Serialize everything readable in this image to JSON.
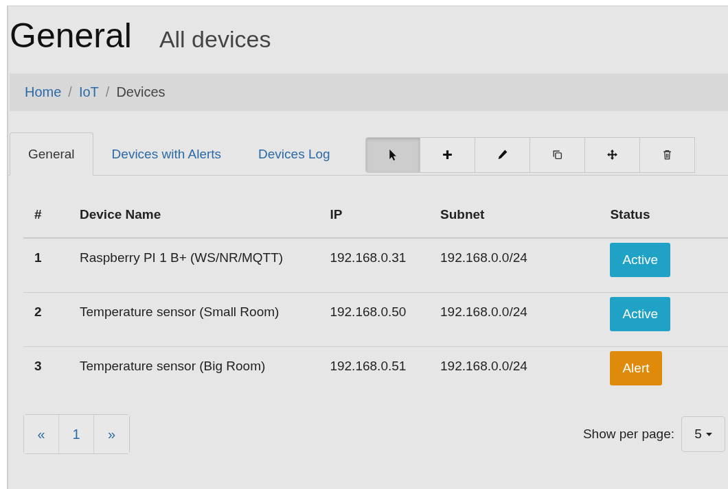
{
  "header": {
    "title": "General",
    "subtitle": "All devices"
  },
  "breadcrumb": [
    {
      "label": "Home",
      "link": true
    },
    {
      "separator": "/",
      "label": "IoT",
      "link": true
    },
    {
      "separator": "/",
      "label": "Devices",
      "link": false
    }
  ],
  "tabs": [
    {
      "label": "General",
      "selected": true
    },
    {
      "label": "Devices with Alerts",
      "selected": false
    },
    {
      "label": "Devices Log",
      "selected": false
    }
  ],
  "toolbar": [
    {
      "kind": "pointer",
      "selected": true
    },
    {
      "kind": "plus",
      "selected": false
    },
    {
      "kind": "pencil",
      "selected": false
    },
    {
      "kind": "copy",
      "selected": false
    },
    {
      "kind": "move",
      "selected": false
    },
    {
      "kind": "trash",
      "selected": false
    }
  ],
  "table": {
    "columns": [
      "#",
      "Device Name",
      "IP",
      "Subnet",
      "Status"
    ],
    "rows": [
      {
        "index": "1",
        "name": "Raspberry PI 1 B+ (WS/NR/MQTT)",
        "ip": "192.168.0.31",
        "subnet": "192.168.0.0/24",
        "status": "Active",
        "color": "#1fa2c6"
      },
      {
        "index": "2",
        "name": "Temperature sensor (Small Room)",
        "ip": "192.168.0.50",
        "subnet": "192.168.0.0/24",
        "status": "Active",
        "color": "#1fa2c6"
      },
      {
        "index": "3",
        "name": "Temperature sensor (Big Room)",
        "ip": "192.168.0.51",
        "subnet": "192.168.0.0/24",
        "status": "Alert",
        "color": "#e08a0b"
      }
    ]
  },
  "pagination": [
    "«",
    "1",
    "»"
  ],
  "per_page": {
    "label": "Show per page:",
    "value": "5"
  }
}
